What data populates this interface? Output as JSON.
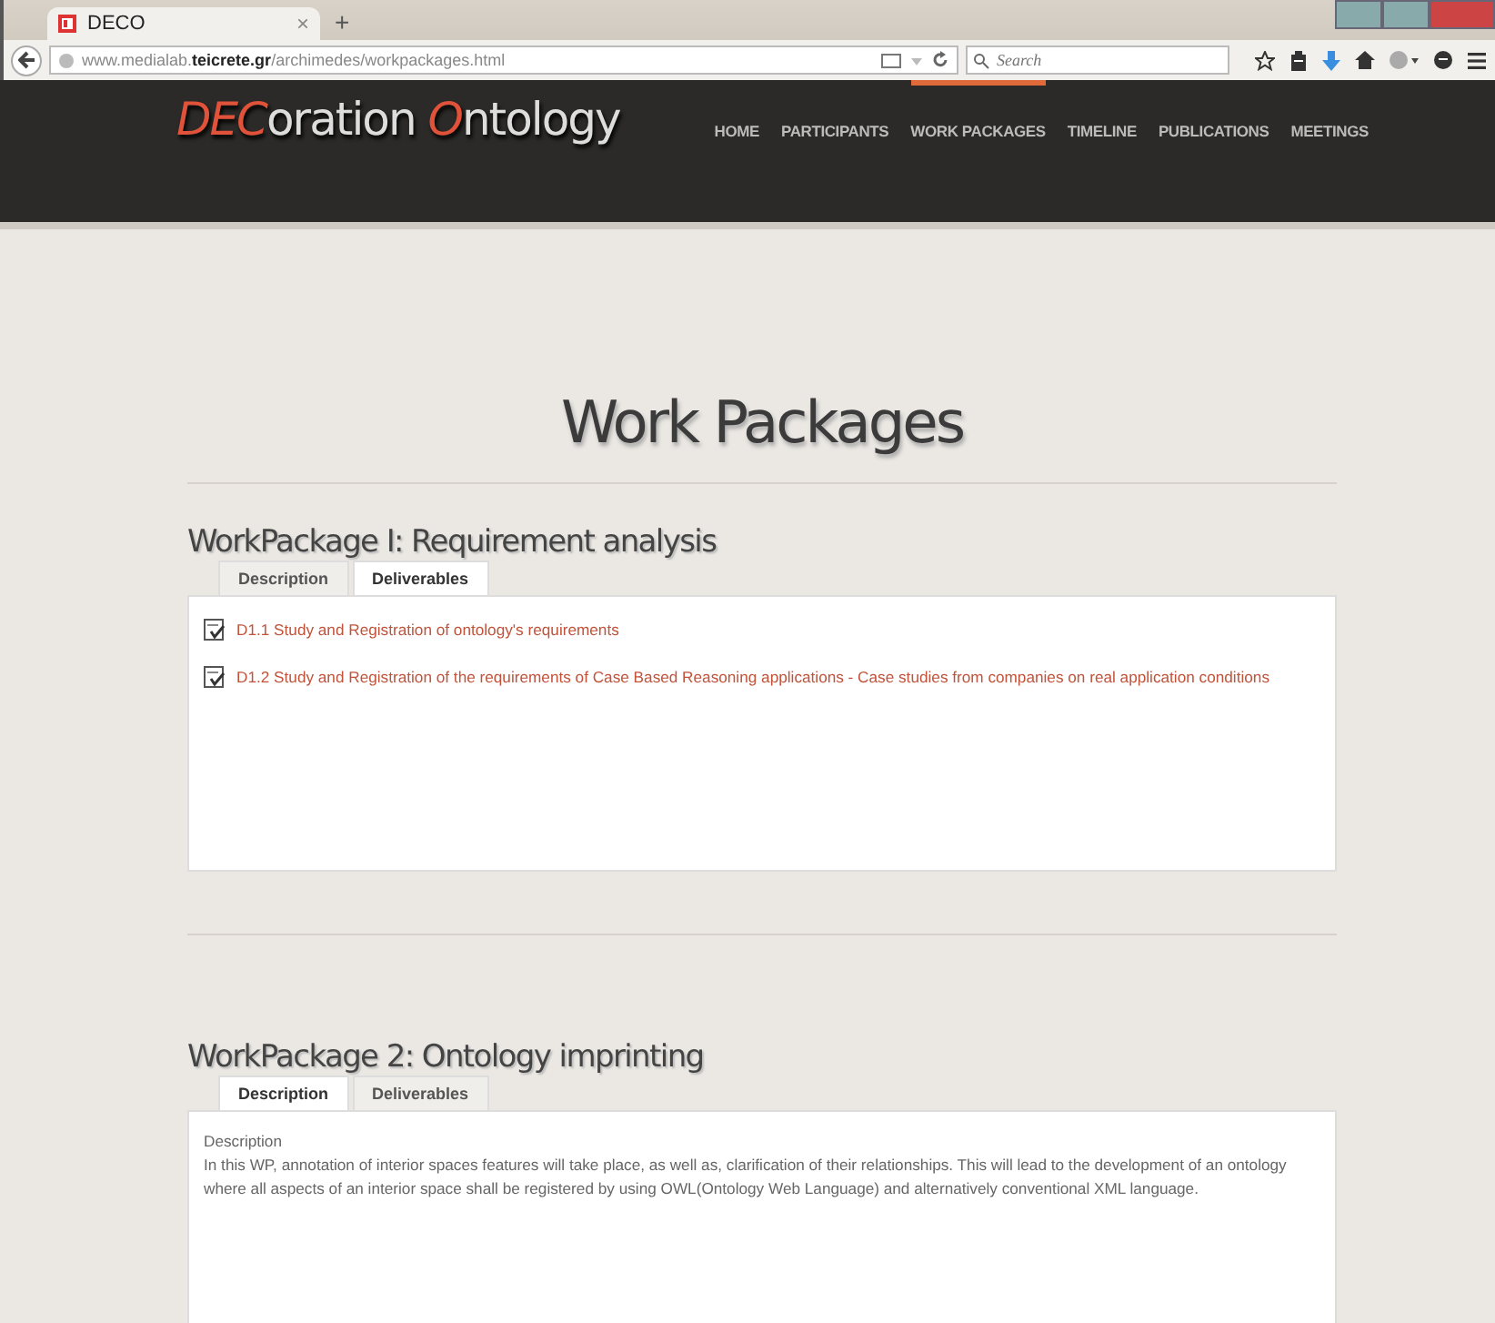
{
  "browser": {
    "tab": {
      "title": "DECO",
      "close": "×"
    },
    "new_tab": "+",
    "url": "www.medialab.**teicrete.gr**/archimedes/workpackages.html",
    "search": {
      "placeholder": "Search"
    }
  },
  "header": {
    "logo": [
      {
        "text": "DEC",
        "accent": true
      },
      {
        "text": "oration ",
        "accent": false
      },
      {
        "text": "O",
        "accent": true
      },
      {
        "text": "ntology",
        "accent": false
      }
    ],
    "nav": [
      {
        "label": "HOME",
        "selected": false
      },
      {
        "label": "PARTICIPANTS",
        "selected": false
      },
      {
        "label": "WORK PACKAGES",
        "selected": true
      },
      {
        "label": "TIMELINE",
        "selected": false
      },
      {
        "label": "PUBLICATIONS",
        "selected": false
      },
      {
        "label": "MEETINGS",
        "selected": false
      }
    ]
  },
  "page_title": "Work Packages",
  "work_packages": [
    {
      "title": "WorkPackage I: Requirement analysis",
      "tabs": [
        {
          "label": "Description",
          "selected": false
        },
        {
          "label": "Deliverables",
          "selected": true
        }
      ],
      "content": {
        "kind": "deliverables",
        "items": [
          "D1.1 Study and Registration of ontology's requirements",
          "D1.2 Study and Registration of the requirements of Case Based Reasoning applications - Case studies from companies on real application conditions"
        ]
      }
    },
    {
      "title": "WorkPackage 2: Ontology imprinting",
      "tabs": [
        {
          "label": "Description",
          "selected": true
        },
        {
          "label": "Deliverables",
          "selected": false
        }
      ],
      "content": {
        "kind": "description",
        "heading": "Description",
        "text": "In this WP, annotation of interior spaces features will take place, as well as, clarification of their relationships. This will lead to the development of an ontology where all aspects of an interior space shall be registered by using OWL(Ontology Web Language) and alternatively conventional XML language."
      }
    }
  ]
}
